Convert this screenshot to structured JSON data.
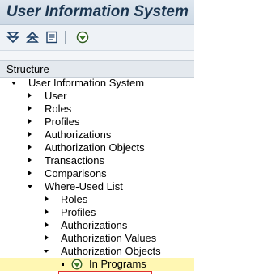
{
  "window": {
    "title": "User Information System"
  },
  "toolbar": {
    "buttons": [
      {
        "icon": "expand-all-icon"
      },
      {
        "icon": "collapse-all-icon"
      },
      {
        "icon": "documentation-icon"
      },
      {
        "icon": "execute-icon"
      }
    ]
  },
  "tree": {
    "header": "Structure",
    "root": "User Information System",
    "items": [
      "User",
      "Roles",
      "Profiles",
      "Authorizations",
      "Authorization Objects",
      "Transactions",
      "Comparisons",
      "Where-Used List"
    ],
    "where_used": [
      "Roles",
      "Profiles",
      "Authorizations",
      "Authorization Values",
      "Authorization Objects"
    ],
    "selected_leaf": "In Programs"
  },
  "colors": {
    "selection": "#fff7b3",
    "title_text": "#1a3550"
  }
}
